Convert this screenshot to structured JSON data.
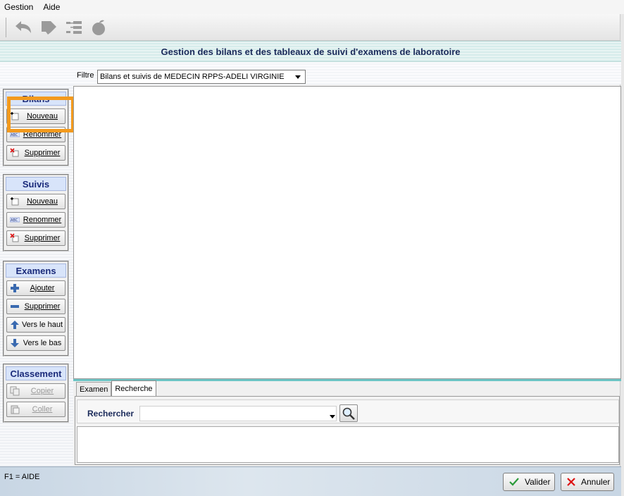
{
  "menu": {
    "items": [
      {
        "label": "Gestion"
      },
      {
        "label": "Aide"
      }
    ]
  },
  "toolbar": {
    "icons": [
      "back-arrow-icon",
      "tag-icon",
      "tree-structure-icon",
      "apple-icon"
    ]
  },
  "header": {
    "title": "Gestion des bilans et des tableaux de suivi d'examens de laboratoire"
  },
  "filter": {
    "label": "Filtre",
    "value": "Bilans et suivis de MEDECIN RPPS-ADELI VIRGINIE"
  },
  "groups": {
    "bilans": {
      "title": "Bilans",
      "buttons": [
        {
          "label": "Nouveau",
          "icon": "new-doc-icon"
        },
        {
          "label": "Renommer",
          "icon": "rename-abc-icon"
        },
        {
          "label": "Supprimer",
          "icon": "delete-x-icon"
        }
      ]
    },
    "suivis": {
      "title": "Suivis",
      "buttons": [
        {
          "label": "Nouveau",
          "icon": "new-doc-icon"
        },
        {
          "label": "Renommer",
          "icon": "rename-abc-icon"
        },
        {
          "label": "Supprimer",
          "icon": "delete-x-icon"
        }
      ]
    },
    "examens": {
      "title": "Examens",
      "buttons": [
        {
          "label": "Ajouter",
          "icon": "plus-icon"
        },
        {
          "label": "Supprimer",
          "icon": "minus-icon"
        },
        {
          "label": "Vers le haut",
          "icon": "arrow-up-icon"
        },
        {
          "label": "Vers le bas",
          "icon": "arrow-down-icon"
        }
      ]
    },
    "classement": {
      "title": "Classement",
      "buttons": [
        {
          "label": "Copier",
          "icon": "copy-icon"
        },
        {
          "label": "Coller",
          "icon": "paste-icon"
        }
      ]
    }
  },
  "tabs": [
    {
      "label": "Examen"
    },
    {
      "label": "Recherche"
    }
  ],
  "search": {
    "label": "Rechercher",
    "value": ""
  },
  "status": {
    "help_text": "F1 = AIDE"
  },
  "actions": {
    "validate_label": "Valider",
    "cancel_label": "Annuler"
  },
  "colors": {
    "highlight": "#f39a1d",
    "group_header": "#d8e4fa",
    "accent_teal": "#6cc4c4"
  }
}
